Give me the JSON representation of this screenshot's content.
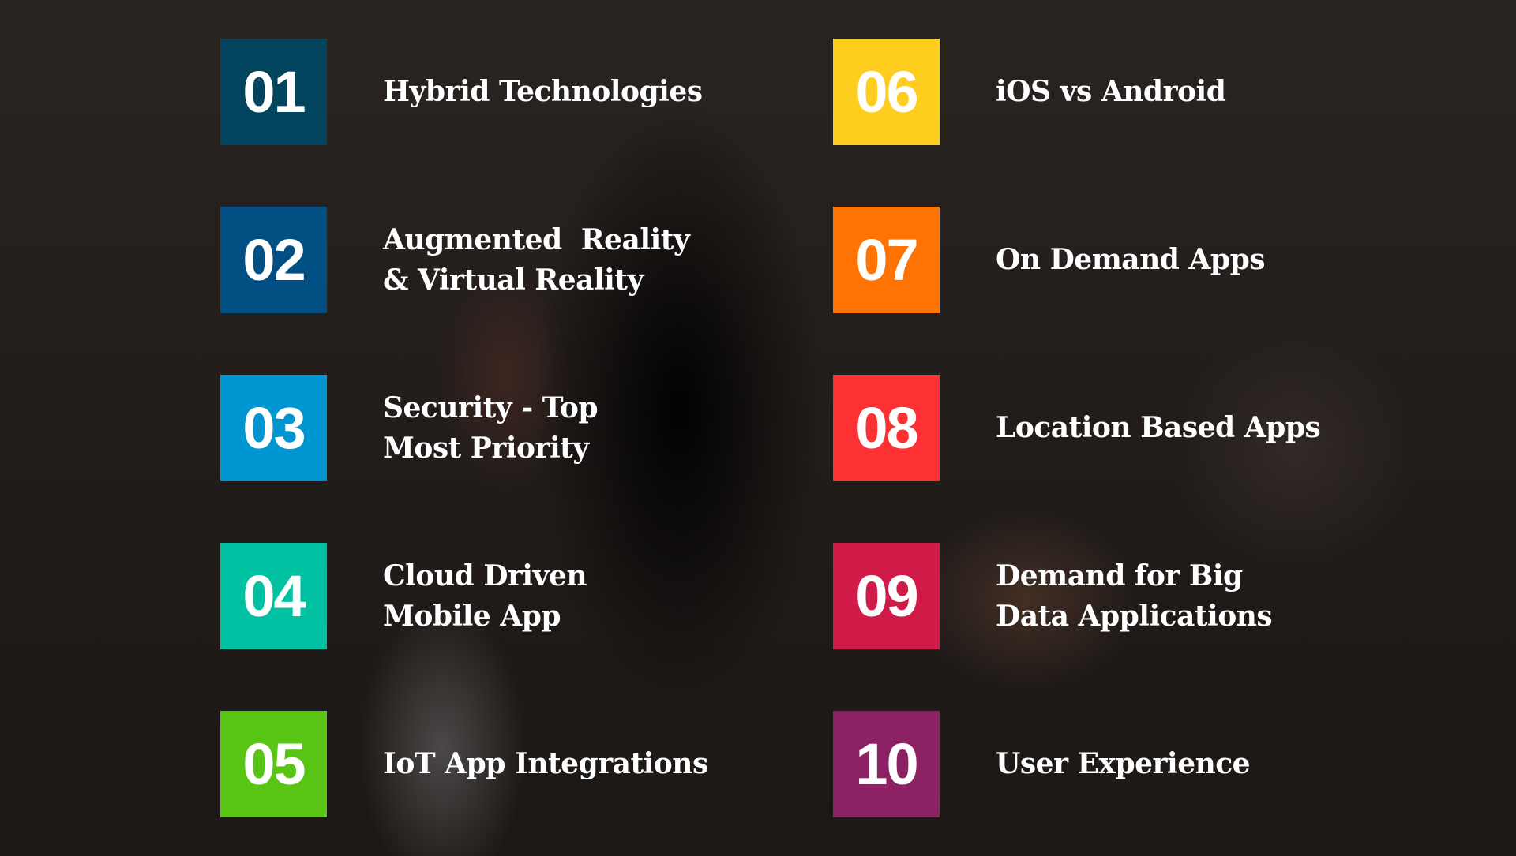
{
  "items": [
    {
      "number": "01",
      "label": "Hybrid Technologies",
      "color": "#03455f"
    },
    {
      "number": "02",
      "label": "Augmented  Reality\n& Virtual Reality",
      "color": "#024f83"
    },
    {
      "number": "03",
      "label": "Security - Top\nMost Priority",
      "color": "#0096d1"
    },
    {
      "number": "04",
      "label": "Cloud Driven\nMobile App",
      "color": "#00c1a1"
    },
    {
      "number": "05",
      "label": "IoT App Integrations",
      "color": "#58c514"
    },
    {
      "number": "06",
      "label": "iOS vs Android",
      "color": "#fecd1e"
    },
    {
      "number": "07",
      "label": "On Demand Apps",
      "color": "#fe7303"
    },
    {
      "number": "08",
      "label": "Location Based Apps",
      "color": "#fd3134"
    },
    {
      "number": "09",
      "label": "Demand for Big\nData Applications",
      "color": "#d01a48"
    },
    {
      "number": "10",
      "label": "User Experience",
      "color": "#8c2263"
    }
  ]
}
